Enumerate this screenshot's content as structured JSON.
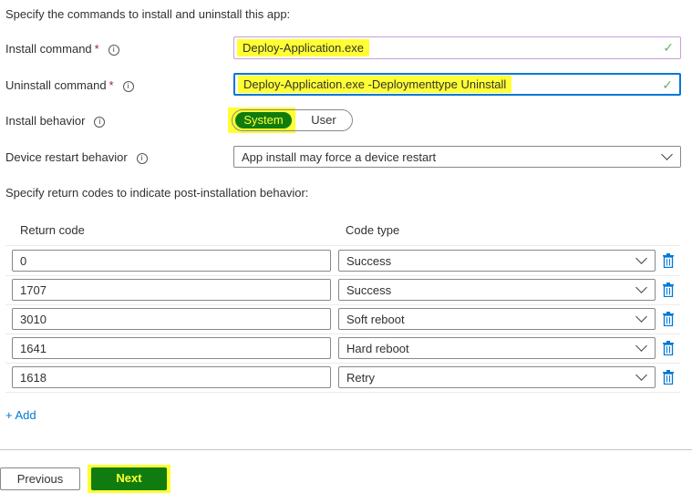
{
  "intro": "Specify the commands to install and uninstall this app:",
  "install": {
    "label": "Install command",
    "value": "Deploy-Application.exe"
  },
  "uninstall": {
    "label": "Uninstall command",
    "value": "Deploy-Application.exe -Deploymenttype Uninstall"
  },
  "behavior": {
    "label": "Install behavior",
    "options": [
      "System",
      "User"
    ],
    "selected": "System"
  },
  "restart": {
    "label": "Device restart behavior",
    "value": "App install may force a device restart"
  },
  "required_mark": "*",
  "info_glyph": "i",
  "return_intro": "Specify return codes to indicate post-installation behavior:",
  "table": {
    "headers": [
      "Return code",
      "Code type"
    ],
    "rows": [
      {
        "code": "0",
        "type": "Success"
      },
      {
        "code": "1707",
        "type": "Success"
      },
      {
        "code": "3010",
        "type": "Soft reboot"
      },
      {
        "code": "1641",
        "type": "Hard reboot"
      },
      {
        "code": "1618",
        "type": "Retry"
      }
    ]
  },
  "add_label": "+ Add",
  "footer": {
    "previous": "Previous",
    "next": "Next"
  },
  "colors": {
    "accent": "#0078d4",
    "highlight": "#ffff33",
    "primary": "#107c10"
  }
}
